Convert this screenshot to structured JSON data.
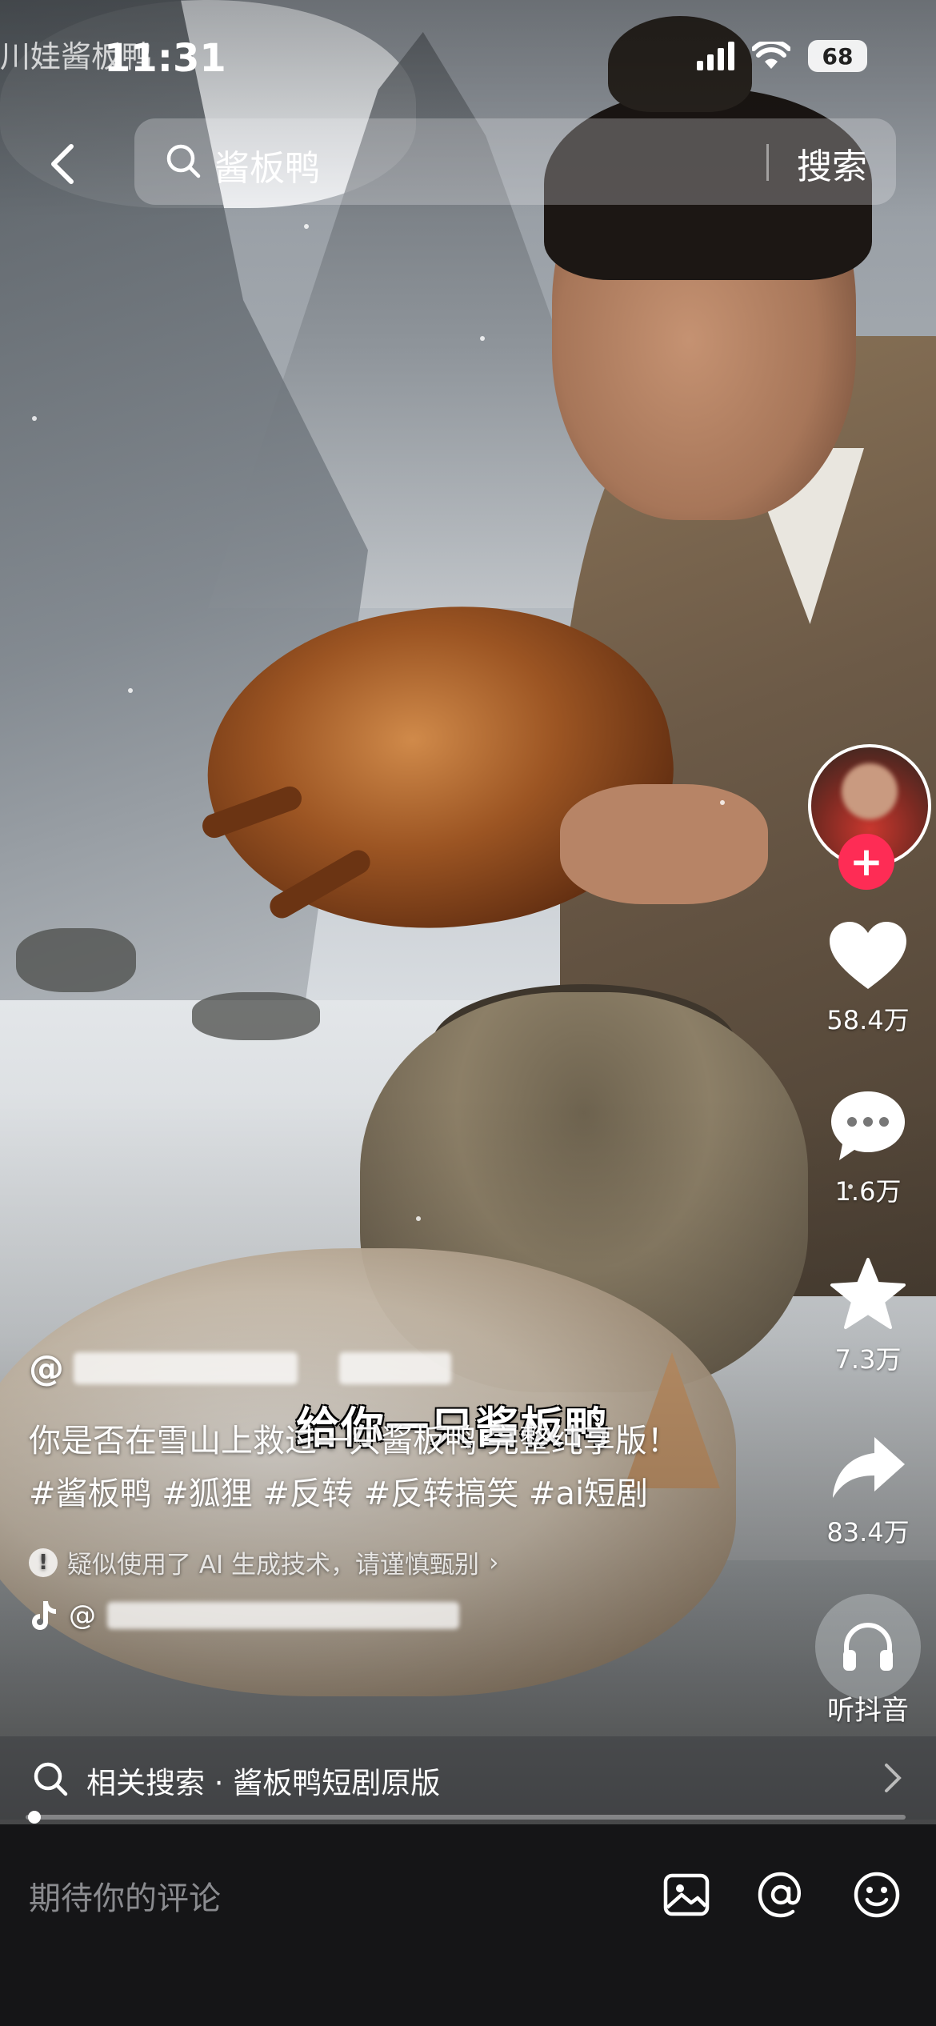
{
  "watermark": "川娃酱板鸭",
  "status_bar": {
    "time": "11:31",
    "battery": "68"
  },
  "search": {
    "query": "酱板鸭",
    "button": "搜索"
  },
  "actions": {
    "likes": "58.4万",
    "comments": "1.6万",
    "favorites": "7.3万",
    "shares": "83.4万",
    "listen": "听抖音"
  },
  "post": {
    "author_prefix": "@",
    "description": "你是否在雪山上救过一只酱板鸭 完整纯享版！",
    "hashtags": "#酱板鸭 #狐狸 #反转 #反转搞笑 #ai短剧",
    "ai_notice": "疑似使用了 AI 生成技术，请谨慎甄别",
    "music_prefix": "@"
  },
  "subtitle": "给你一只酱板鸭",
  "related_search": {
    "label": "相关搜索 · 酱板鸭短剧原版"
  },
  "comment": {
    "placeholder": "期待你的评论"
  },
  "colors": {
    "follow": "#fe2c55",
    "comment_bar": "#151517"
  },
  "video_progress": 0.01
}
